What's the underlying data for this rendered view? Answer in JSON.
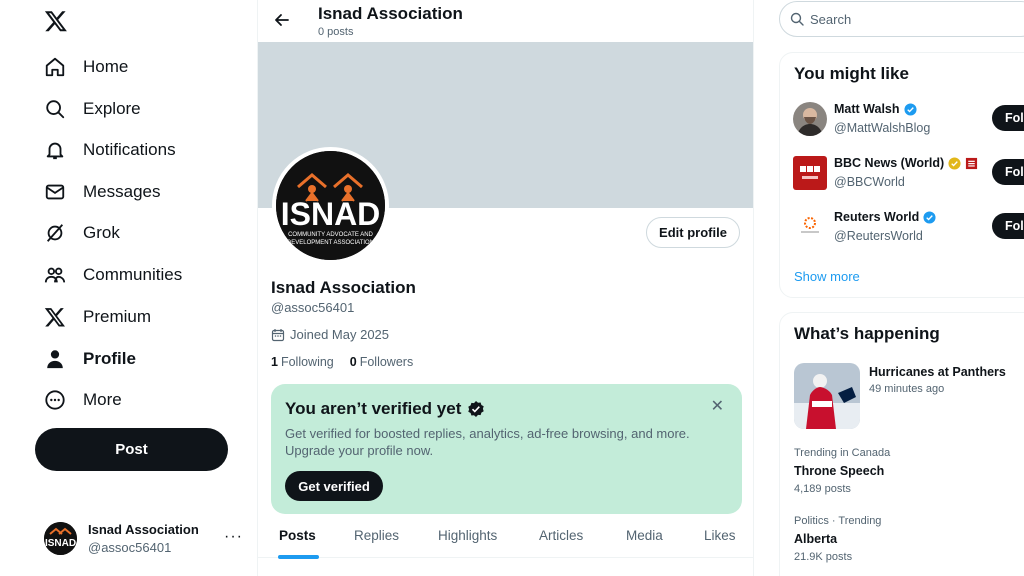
{
  "nav": {
    "items": [
      {
        "label": "Home",
        "icon": "home-icon"
      },
      {
        "label": "Explore",
        "icon": "search-icon"
      },
      {
        "label": "Notifications",
        "icon": "bell-icon"
      },
      {
        "label": "Messages",
        "icon": "envelope-icon"
      },
      {
        "label": "Grok",
        "icon": "grok-icon"
      },
      {
        "label": "Communities",
        "icon": "people-icon"
      },
      {
        "label": "Premium",
        "icon": "x-icon"
      },
      {
        "label": "Profile",
        "icon": "person-icon"
      },
      {
        "label": "More",
        "icon": "more-circle-icon"
      }
    ],
    "post_label": "Post"
  },
  "account": {
    "name": "Isnad Association",
    "handle": "@assoc56401",
    "more": "···"
  },
  "header": {
    "name": "Isnad Association",
    "post_count": "0 posts"
  },
  "profile": {
    "avatar_text": "ISNAD",
    "avatar_subtext_1": "COMMUNITY ADVOCATE AND",
    "avatar_subtext_2": "DEVELOPMENT ASSOCIATION",
    "edit_label": "Edit profile",
    "name": "Isnad Association",
    "handle": "@assoc56401",
    "joined": "Joined May 2025",
    "following_count": "1",
    "following_label": "Following",
    "followers_count": "0",
    "followers_label": "Followers"
  },
  "verify": {
    "title": "You aren’t verified yet",
    "description": "Get verified for boosted replies, analytics, ad-free browsing, and more. Upgrade your profile now.",
    "button": "Get verified",
    "close": "✕"
  },
  "tabs": [
    "Posts",
    "Replies",
    "Highlights",
    "Articles",
    "Media",
    "Likes"
  ],
  "search": {
    "placeholder": "Search"
  },
  "suggestions": {
    "title": "You might like",
    "users": [
      {
        "name": "Matt Walsh",
        "handle": "@MattWalshBlog",
        "button": "Foll"
      },
      {
        "name": "BBC News (World)",
        "handle": "@BBCWorld",
        "button": "Foll"
      },
      {
        "name": "Reuters World",
        "handle": "@ReutersWorld",
        "button": "Foll"
      }
    ],
    "show_more": "Show more"
  },
  "happening": {
    "title": "What’s happening",
    "featured": {
      "title": "Hurricanes at Panthers",
      "time": "49 minutes ago"
    },
    "trends": [
      {
        "context": "Trending in Canada",
        "title": "Throne Speech",
        "posts": "4,189 posts"
      },
      {
        "context": "Politics · Trending",
        "title": "Alberta",
        "posts": "21.9K posts"
      }
    ]
  },
  "colors": {
    "accent": "#1d9bf0",
    "verify_card_bg": "#c3ecd9",
    "banner": "#cfd9de",
    "text_primary": "#0f1419",
    "text_secondary": "#536471"
  }
}
